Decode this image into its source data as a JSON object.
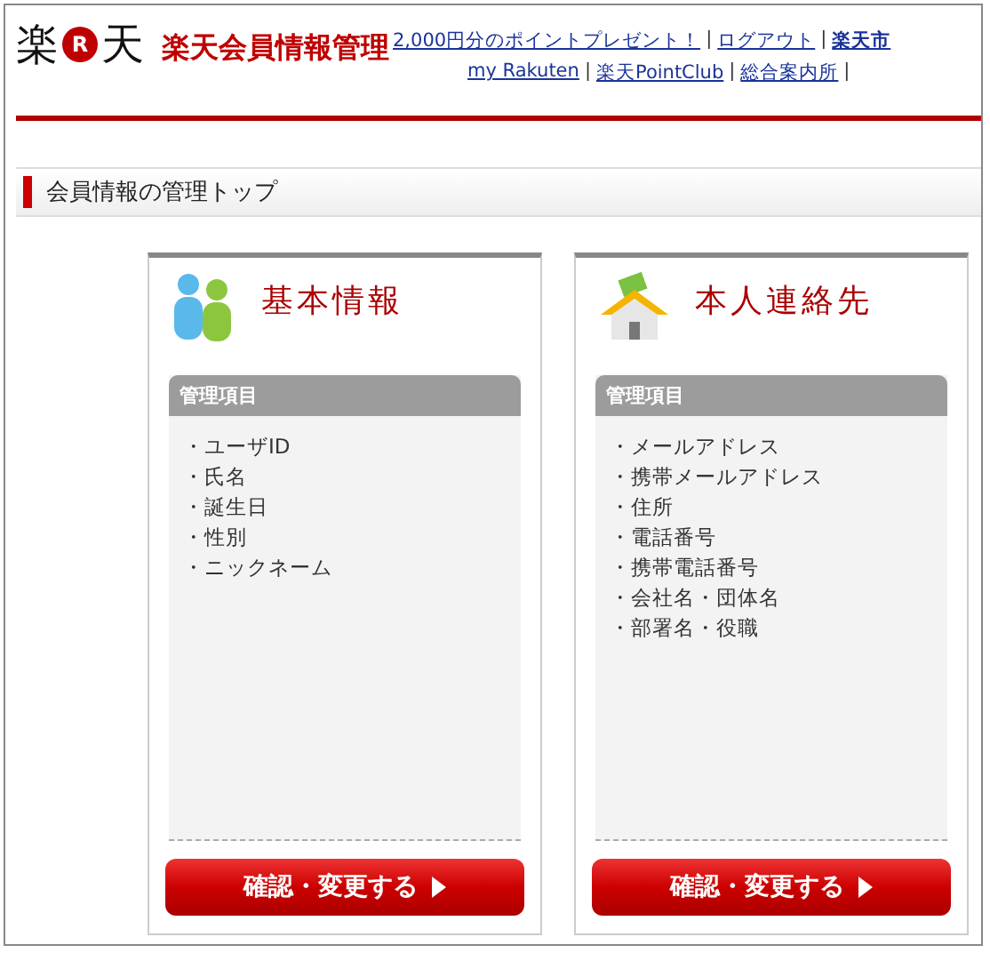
{
  "header": {
    "logo": {
      "left": "楽",
      "mark": "R",
      "right": "天"
    },
    "title": "楽天会員情報管理",
    "links_row_1": [
      {
        "kind": "link",
        "text": "2,000円分のポイントプレゼント！"
      },
      {
        "kind": "separator",
        "text": "|"
      },
      {
        "kind": "link",
        "text": "ログアウト"
      },
      {
        "kind": "separator",
        "text": "|"
      },
      {
        "kind": "strong_link",
        "text": "楽天市"
      }
    ],
    "links_row_2": [
      {
        "kind": "link",
        "text": "my Rakuten"
      },
      {
        "kind": "separator",
        "text": "|"
      },
      {
        "kind": "link",
        "text": "楽天PointClub"
      },
      {
        "kind": "separator",
        "text": "|"
      },
      {
        "kind": "link",
        "text": "総合案内所"
      },
      {
        "kind": "separator",
        "text": "|"
      }
    ]
  },
  "section_title": "会員情報の管理トップ",
  "cards": [
    {
      "kind": "people",
      "title": "基本情報",
      "list_heading": "管理項目",
      "items": [
        "・ユーザID",
        "・氏名",
        "・誕生日",
        "・性別",
        "・ニックネーム"
      ],
      "button": "確認・変更する"
    },
    {
      "kind": "house",
      "title": "本人連絡先",
      "list_heading": "管理項目",
      "items": [
        "・メールアドレス",
        "・携帯メールアドレス",
        "・住所",
        "・電話番号",
        "・携帯電話番号",
        "・会社名・団体名",
        "・部署名・役職"
      ],
      "button": "確認・変更する"
    }
  ]
}
